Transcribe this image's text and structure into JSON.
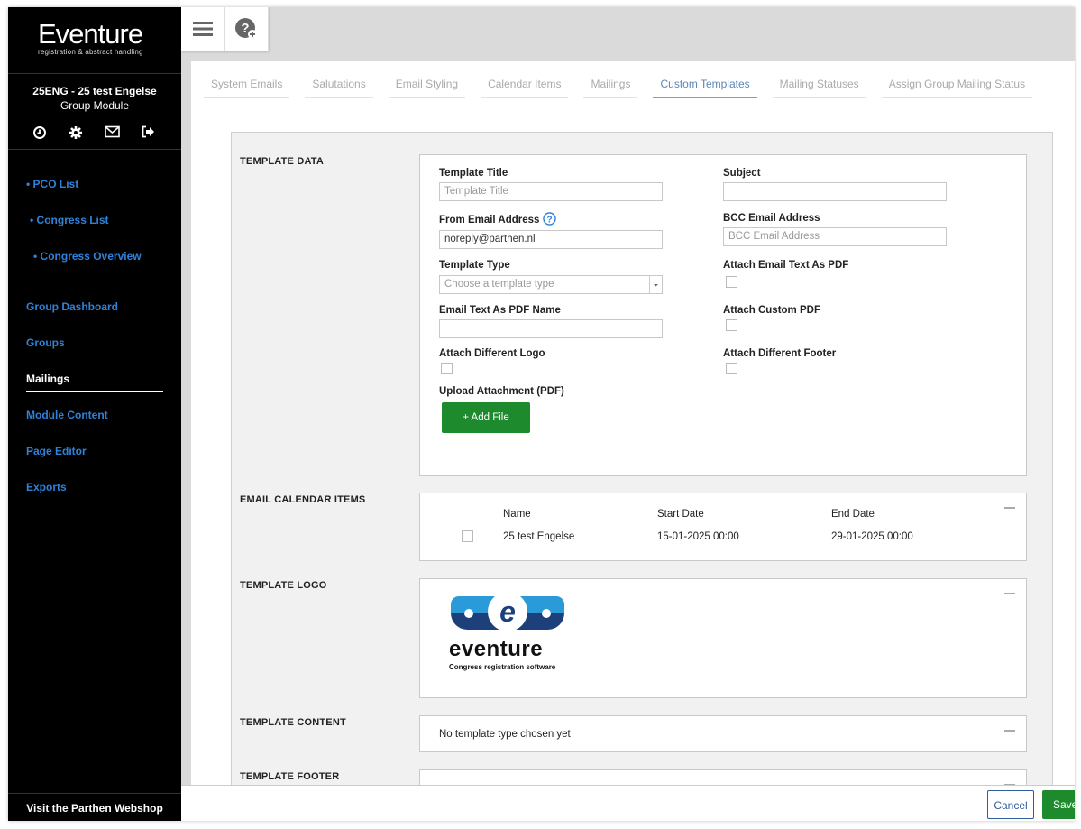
{
  "brand": {
    "name": "Eventure",
    "tagline": "registration & abstract handling"
  },
  "event": {
    "title": "25ENG - 25 test Engelse",
    "subtitle": "Group Module"
  },
  "quick_icons": [
    "clock-icon",
    "gear-icon",
    "envelope-icon",
    "logout-icon"
  ],
  "nav": {
    "pco_list": "• PCO List",
    "congress_list": "• Congress List",
    "congress_overview": "• Congress Overview",
    "group_dashboard": "Group Dashboard",
    "groups": "Groups",
    "mailings": "Mailings",
    "module_content": "Module Content",
    "page_editor": "Page Editor",
    "exports": "Exports"
  },
  "webshop": "Visit the Parthen Webshop",
  "tabs": [
    {
      "label": "System Emails"
    },
    {
      "label": "Salutations"
    },
    {
      "label": "Email Styling"
    },
    {
      "label": "Calendar Items"
    },
    {
      "label": "Mailings"
    },
    {
      "label": "Custom Templates",
      "active": true
    },
    {
      "label": "Mailing Statuses"
    },
    {
      "label": "Assign Group Mailing Status"
    }
  ],
  "sections": {
    "template_data": "TEMPLATE DATA",
    "email_calendar_items": "EMAIL CALENDAR ITEMS",
    "template_logo": "TEMPLATE LOGO",
    "template_content": "TEMPLATE CONTENT",
    "template_footer": "TEMPLATE FOOTER"
  },
  "form": {
    "template_title_label": "Template Title",
    "template_title_placeholder": "Template Title",
    "subject_label": "Subject",
    "subject_value": "",
    "from_email_label": "From Email Address",
    "from_email_value": "noreply@parthen.nl",
    "bcc_label": "BCC Email Address",
    "bcc_placeholder": "BCC Email Address",
    "template_type_label": "Template Type",
    "template_type_placeholder": "Choose a template type",
    "attach_pdf_label": "Attach Email Text As PDF",
    "pdf_name_label": "Email Text As PDF Name",
    "attach_custom_pdf_label": "Attach Custom PDF",
    "attach_logo_label": "Attach Different Logo",
    "attach_footer_label": "Attach Different Footer",
    "upload_label": "Upload Attachment (PDF)",
    "add_file_button": "+ Add File"
  },
  "calendar": {
    "columns": [
      "Name",
      "Start Date",
      "End Date"
    ],
    "rows": [
      {
        "name": "25 test Engelse",
        "start": "15-01-2025 00:00",
        "end": "29-01-2025 00:00"
      }
    ]
  },
  "logo": {
    "wordmark": "eventure",
    "tagline": "Congress registration software"
  },
  "template_content_text": "No template type chosen yet",
  "buttons": {
    "cancel": "Cancel",
    "save": "Save"
  },
  "colors": {
    "nav_link": "#2f82d9",
    "add_file": "#1e8a2e",
    "active_tab": "#5a86b8",
    "logo_dark": "#1d3f7a",
    "logo_light": "#2a9ad8"
  }
}
